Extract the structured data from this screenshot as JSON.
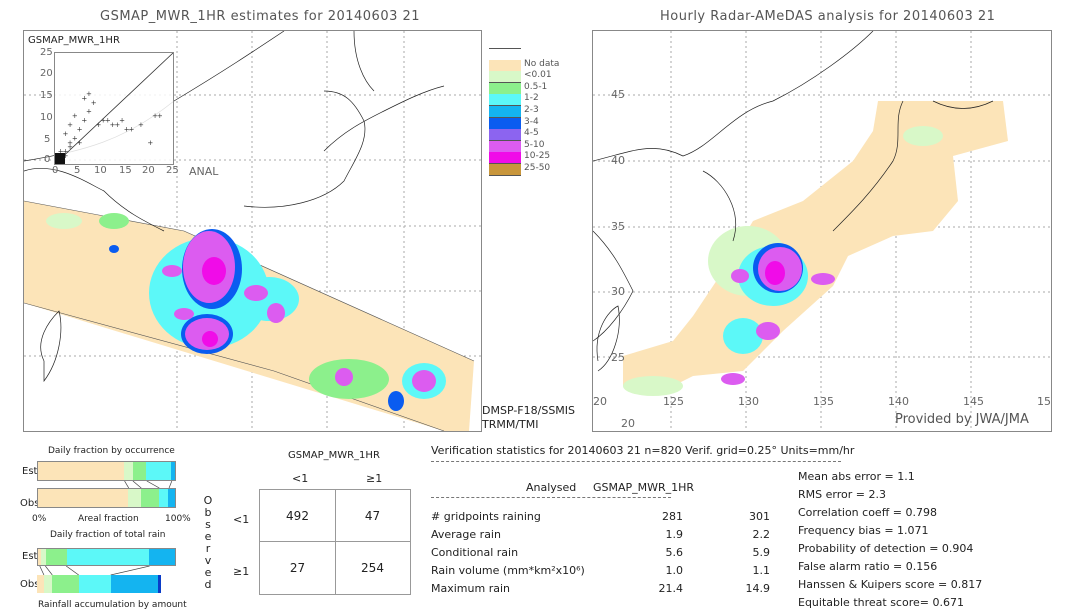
{
  "left_panel": {
    "title": "GSMAP_MWR_1HR estimates for 20140603 21",
    "scatter": {
      "y_label": "GSMAP_MWR_1HR",
      "x_label": "ANAL",
      "y_ticks": [
        "25",
        "20",
        "15",
        "10",
        "5",
        "0"
      ],
      "x_ticks": [
        "0",
        "5",
        "10",
        "15",
        "20",
        "25"
      ]
    },
    "satellites": [
      "DMSP-F18/SSMIS",
      "TRMM/TMI"
    ]
  },
  "legend": {
    "items": [
      {
        "label": "",
        "color": "#ffffff"
      },
      {
        "label": "No data",
        "color": "#fce4b8"
      },
      {
        "label": "<0.01",
        "color": "#d8f8c8"
      },
      {
        "label": "0.5-1",
        "color": "#8cf08c"
      },
      {
        "label": "1-2",
        "color": "#5cf8f8"
      },
      {
        "label": "2-3",
        "color": "#14b4f0"
      },
      {
        "label": "3-4",
        "color": "#0a5cf0"
      },
      {
        "label": "4-5",
        "color": "#8c64f0"
      },
      {
        "label": "5-10",
        "color": "#dc5cf0"
      },
      {
        "label": "10-25",
        "color": "#f00ce8"
      },
      {
        "label": "25-50",
        "color": "#c8963c"
      }
    ]
  },
  "right_panel": {
    "title": "Hourly Radar-AMeDAS analysis for 20140603 21",
    "lat_ticks": [
      "45",
      "40",
      "35",
      "30",
      "25",
      "20"
    ],
    "lon_ticks": [
      "20",
      "125",
      "130",
      "135",
      "140",
      "145",
      "15"
    ],
    "credit": "Provided by JWA/JMA"
  },
  "occurrence_chart": {
    "title": "Daily fraction by occurrence",
    "rows": [
      {
        "label": "Est",
        "segments": [
          {
            "color": "#fce4b8",
            "fraction": 0.63
          },
          {
            "color": "#d8f8c8",
            "fraction": 0.06
          },
          {
            "color": "#8cf08c",
            "fraction": 0.1
          },
          {
            "color": "#5cf8f8",
            "fraction": 0.18
          },
          {
            "color": "#14b4f0",
            "fraction": 0.03
          }
        ]
      },
      {
        "label": "Obs",
        "segments": [
          {
            "color": "#fce4b8",
            "fraction": 0.66
          },
          {
            "color": "#d8f8c8",
            "fraction": 0.09
          },
          {
            "color": "#8cf08c",
            "fraction": 0.13
          },
          {
            "color": "#5cf8f8",
            "fraction": 0.07
          },
          {
            "color": "#14b4f0",
            "fraction": 0.05
          }
        ]
      }
    ],
    "x_left": "0%",
    "x_mid": "Areal fraction",
    "x_right": "100%"
  },
  "total_rain_chart": {
    "title": "Daily fraction of total rain",
    "rows": [
      {
        "label": "Est",
        "segments": [
          {
            "color": "#fce4b8",
            "fraction": 0.02
          },
          {
            "color": "#d8f8c8",
            "fraction": 0.04
          },
          {
            "color": "#8cf08c",
            "fraction": 0.15
          },
          {
            "color": "#5cf8f8",
            "fraction": 0.6
          },
          {
            "color": "#14b4f0",
            "fraction": 0.19
          }
        ]
      },
      {
        "label": "Obs",
        "segments": [
          {
            "color": "#fce4b8",
            "fraction": 0.05
          },
          {
            "color": "#d8f8c8",
            "fraction": 0.06
          },
          {
            "color": "#8cf08c",
            "fraction": 0.19
          },
          {
            "color": "#5cf8f8",
            "fraction": 0.23
          },
          {
            "color": "#14b4f0",
            "fraction": 0.34
          },
          {
            "color": "#0a3cc8",
            "fraction": 0.02
          }
        ]
      }
    ],
    "caption": "Rainfall accumulation by amount"
  },
  "contingency": {
    "header": "GSMAP_MWR_1HR",
    "col_labels": [
      "<1",
      "≥1"
    ],
    "row_labels": [
      "<1",
      "≥1"
    ],
    "side_label": [
      "O",
      "b",
      "s",
      "e",
      "r",
      "v",
      "e",
      "d"
    ],
    "cells": [
      [
        "492",
        "47"
      ],
      [
        "27",
        "254"
      ]
    ]
  },
  "verification": {
    "header": "Verification statistics for 20140603 21   n=820   Verif. grid=0.25°   Units=mm/hr",
    "col_analysed": "Analysed",
    "col_gsmap": "GSMAP_MWR_1HR",
    "rows": [
      {
        "label": "# gridpoints raining",
        "analysed": "281",
        "gsmap": "301"
      },
      {
        "label": "Average rain",
        "analysed": "1.9",
        "gsmap": "2.2"
      },
      {
        "label": "Conditional rain",
        "analysed": "5.6",
        "gsmap": "5.9"
      },
      {
        "label": "Rain volume (mm*km²x10⁶)",
        "analysed": "1.0",
        "gsmap": "1.1"
      },
      {
        "label": "Maximum rain",
        "analysed": "21.4",
        "gsmap": "14.9"
      }
    ],
    "scores": [
      "Mean abs error = 1.1",
      "RMS error = 2.3",
      "Correlation coeff = 0.798",
      "Frequency bias = 1.071",
      "Probability of detection = 0.904",
      "False alarm ratio = 0.156",
      "Hanssen & Kuipers score = 0.817",
      "Equitable threat score= 0.671"
    ]
  }
}
